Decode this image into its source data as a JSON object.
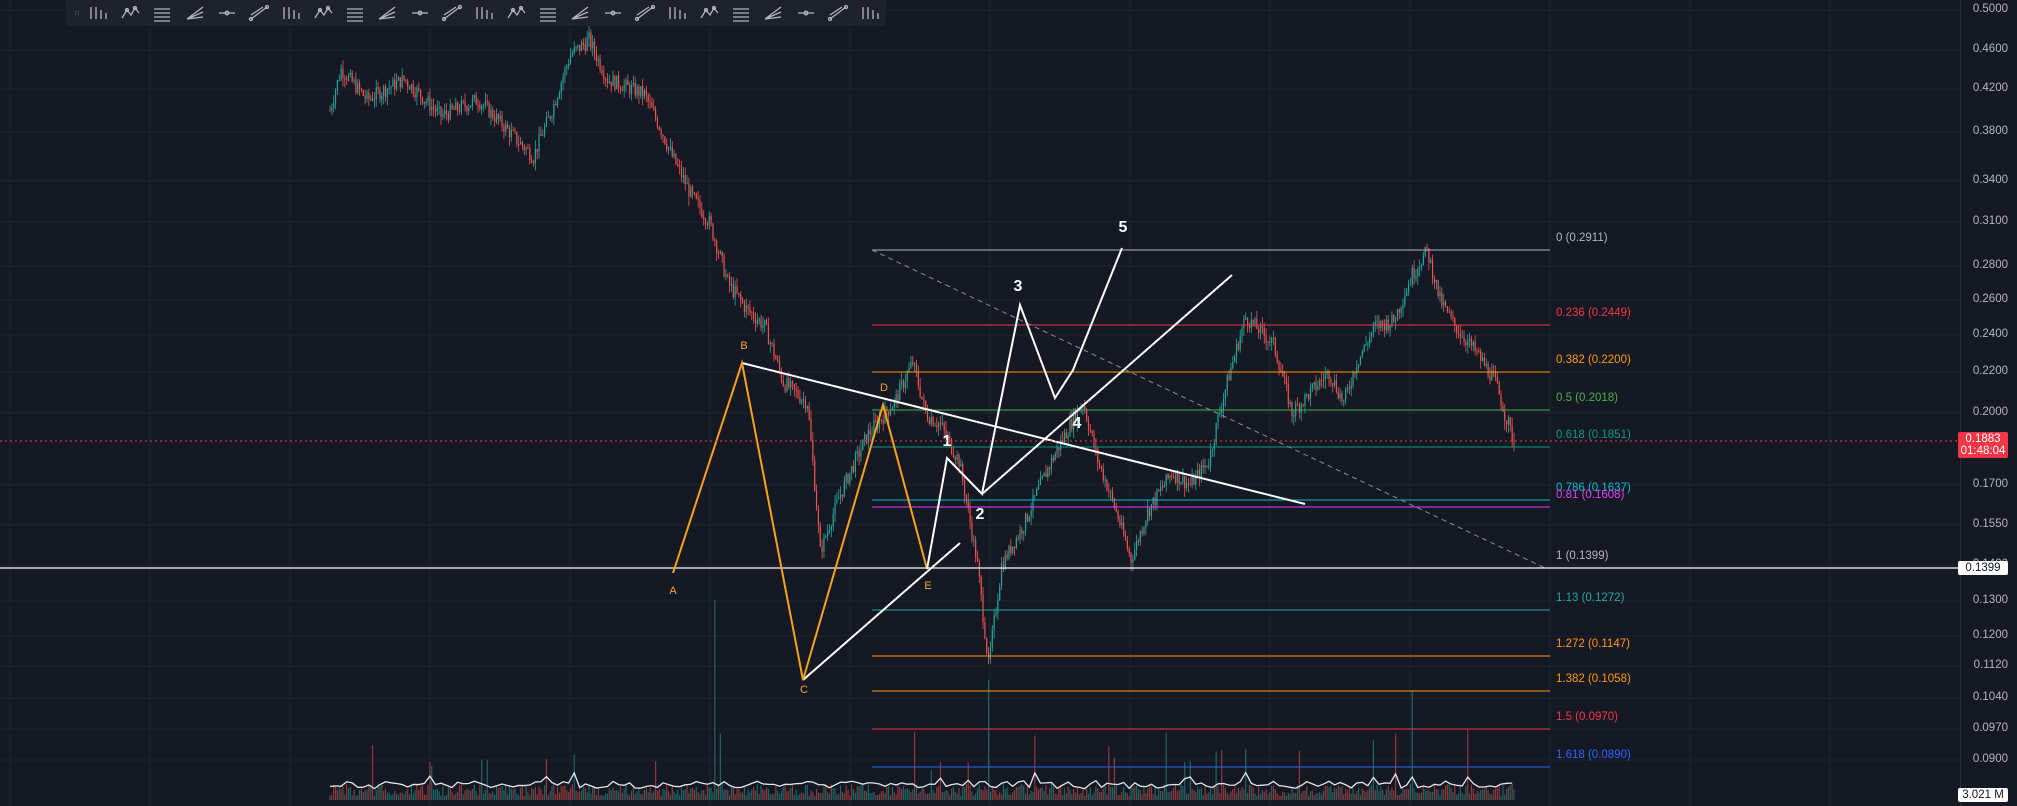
{
  "toolbar": {
    "tools": [
      "drag-handle-icon",
      "trend-lines-icon",
      "pitchfork-icon",
      "channel-icon",
      "parallel-lines-icon",
      "bars-pattern-icon",
      "fan-icon",
      "xabcd-pattern-icon",
      "cypher-pattern-icon",
      "head-shoulders-icon",
      "abcd-pattern-icon",
      "triangle-pattern-icon",
      "three-drives-icon",
      "elliott-impulse-icon",
      "elliott-correction-icon",
      "elliott-triangle-icon",
      "elliott-double-combo-icon",
      "cyclic-lines-icon",
      "time-cycles-icon",
      "sine-line-icon",
      "gann-box-icon",
      "gann-fan-icon",
      "ray-icon",
      "horizontal-ray-icon",
      "trend-angle-icon",
      "polyline-icon"
    ]
  },
  "price_axis": {
    "ticks": [
      "0.5000",
      "0.4600",
      "0.4200",
      "0.3800",
      "0.3400",
      "0.3100",
      "0.2800",
      "0.2600",
      "0.2400",
      "0.2200",
      "0.2000",
      "0.1700",
      "0.1550",
      "0.1400",
      "0.1300",
      "0.1200",
      "0.1120",
      "0.1040",
      "0.0970",
      "0.0900"
    ],
    "current_price": "0.1883",
    "countdown": "01:48:04",
    "line_price": "0.1399",
    "volume_label": "3.021 M"
  },
  "fib_levels": [
    {
      "label": "0 (0.2911)",
      "color": "#b2b5be"
    },
    {
      "label": "0.236 (0.2449)",
      "color": "#f23645"
    },
    {
      "label": "0.382 (0.2200)",
      "color": "#ff9800"
    },
    {
      "label": "0.5 (0.2018)",
      "color": "#4caf50"
    },
    {
      "label": "0.618 (0.1851)",
      "color": "#089981"
    },
    {
      "label": "0.786 (0.1637)",
      "color": "#00bcd4"
    },
    {
      "label": "0.81 (0.1608)",
      "color": "#e040fb"
    },
    {
      "label": "1 (0.1399)",
      "color": "#b2b5be"
    },
    {
      "label": "1.13 (0.1272)",
      "color": "#26a69a"
    },
    {
      "label": "1.272 (0.1147)",
      "color": "#ff9800"
    },
    {
      "label": "1.382 (0.1058)",
      "color": "#ff9800"
    },
    {
      "label": "1.5 (0.0970)",
      "color": "#f23645"
    },
    {
      "label": "1.618 (0.0890)",
      "color": "#2962ff"
    }
  ],
  "harmonic_labels": [
    "A",
    "B",
    "C",
    "D",
    "E"
  ],
  "wave_labels": [
    "1",
    "2",
    "3",
    "4",
    "5"
  ],
  "colors": {
    "background": "#151924",
    "up": "#26a69a",
    "down": "#ef5350",
    "pattern": "#f7a21b",
    "wave": "#ffffff",
    "current_price_tag": "#f23645"
  }
}
